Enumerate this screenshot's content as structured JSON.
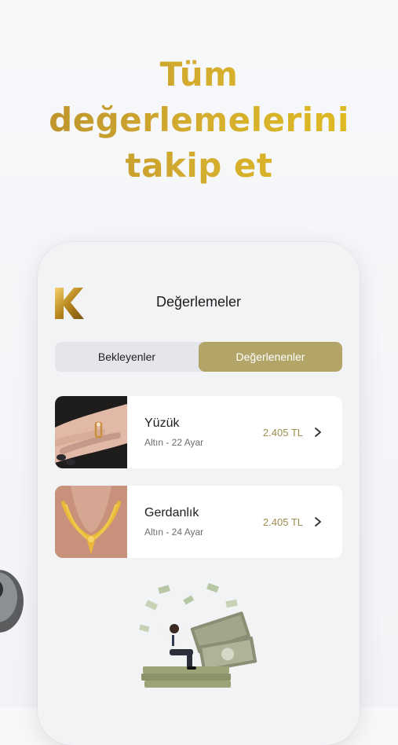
{
  "headline": {
    "line1": "Tüm",
    "line2": "değerlemelerini",
    "line3": "takip et"
  },
  "screen": {
    "title": "Değerlemeler",
    "tabs": [
      {
        "label": "Bekleyenler",
        "active": false
      },
      {
        "label": "Değerlenenler",
        "active": true
      }
    ],
    "items": [
      {
        "name": "Yüzük",
        "detail": "Altın - 22 Ayar",
        "price": "2.405 TL"
      },
      {
        "name": "Gerdanlık",
        "detail": "Altın - 24 Ayar",
        "price": "2.405 TL"
      }
    ]
  },
  "colors": {
    "accent": "#b3a467",
    "gold": "#d4ad2f",
    "price": "#9c8e4c"
  },
  "icons": [
    "logo-k-icon",
    "chevron-right-icon",
    "money-illustration"
  ]
}
